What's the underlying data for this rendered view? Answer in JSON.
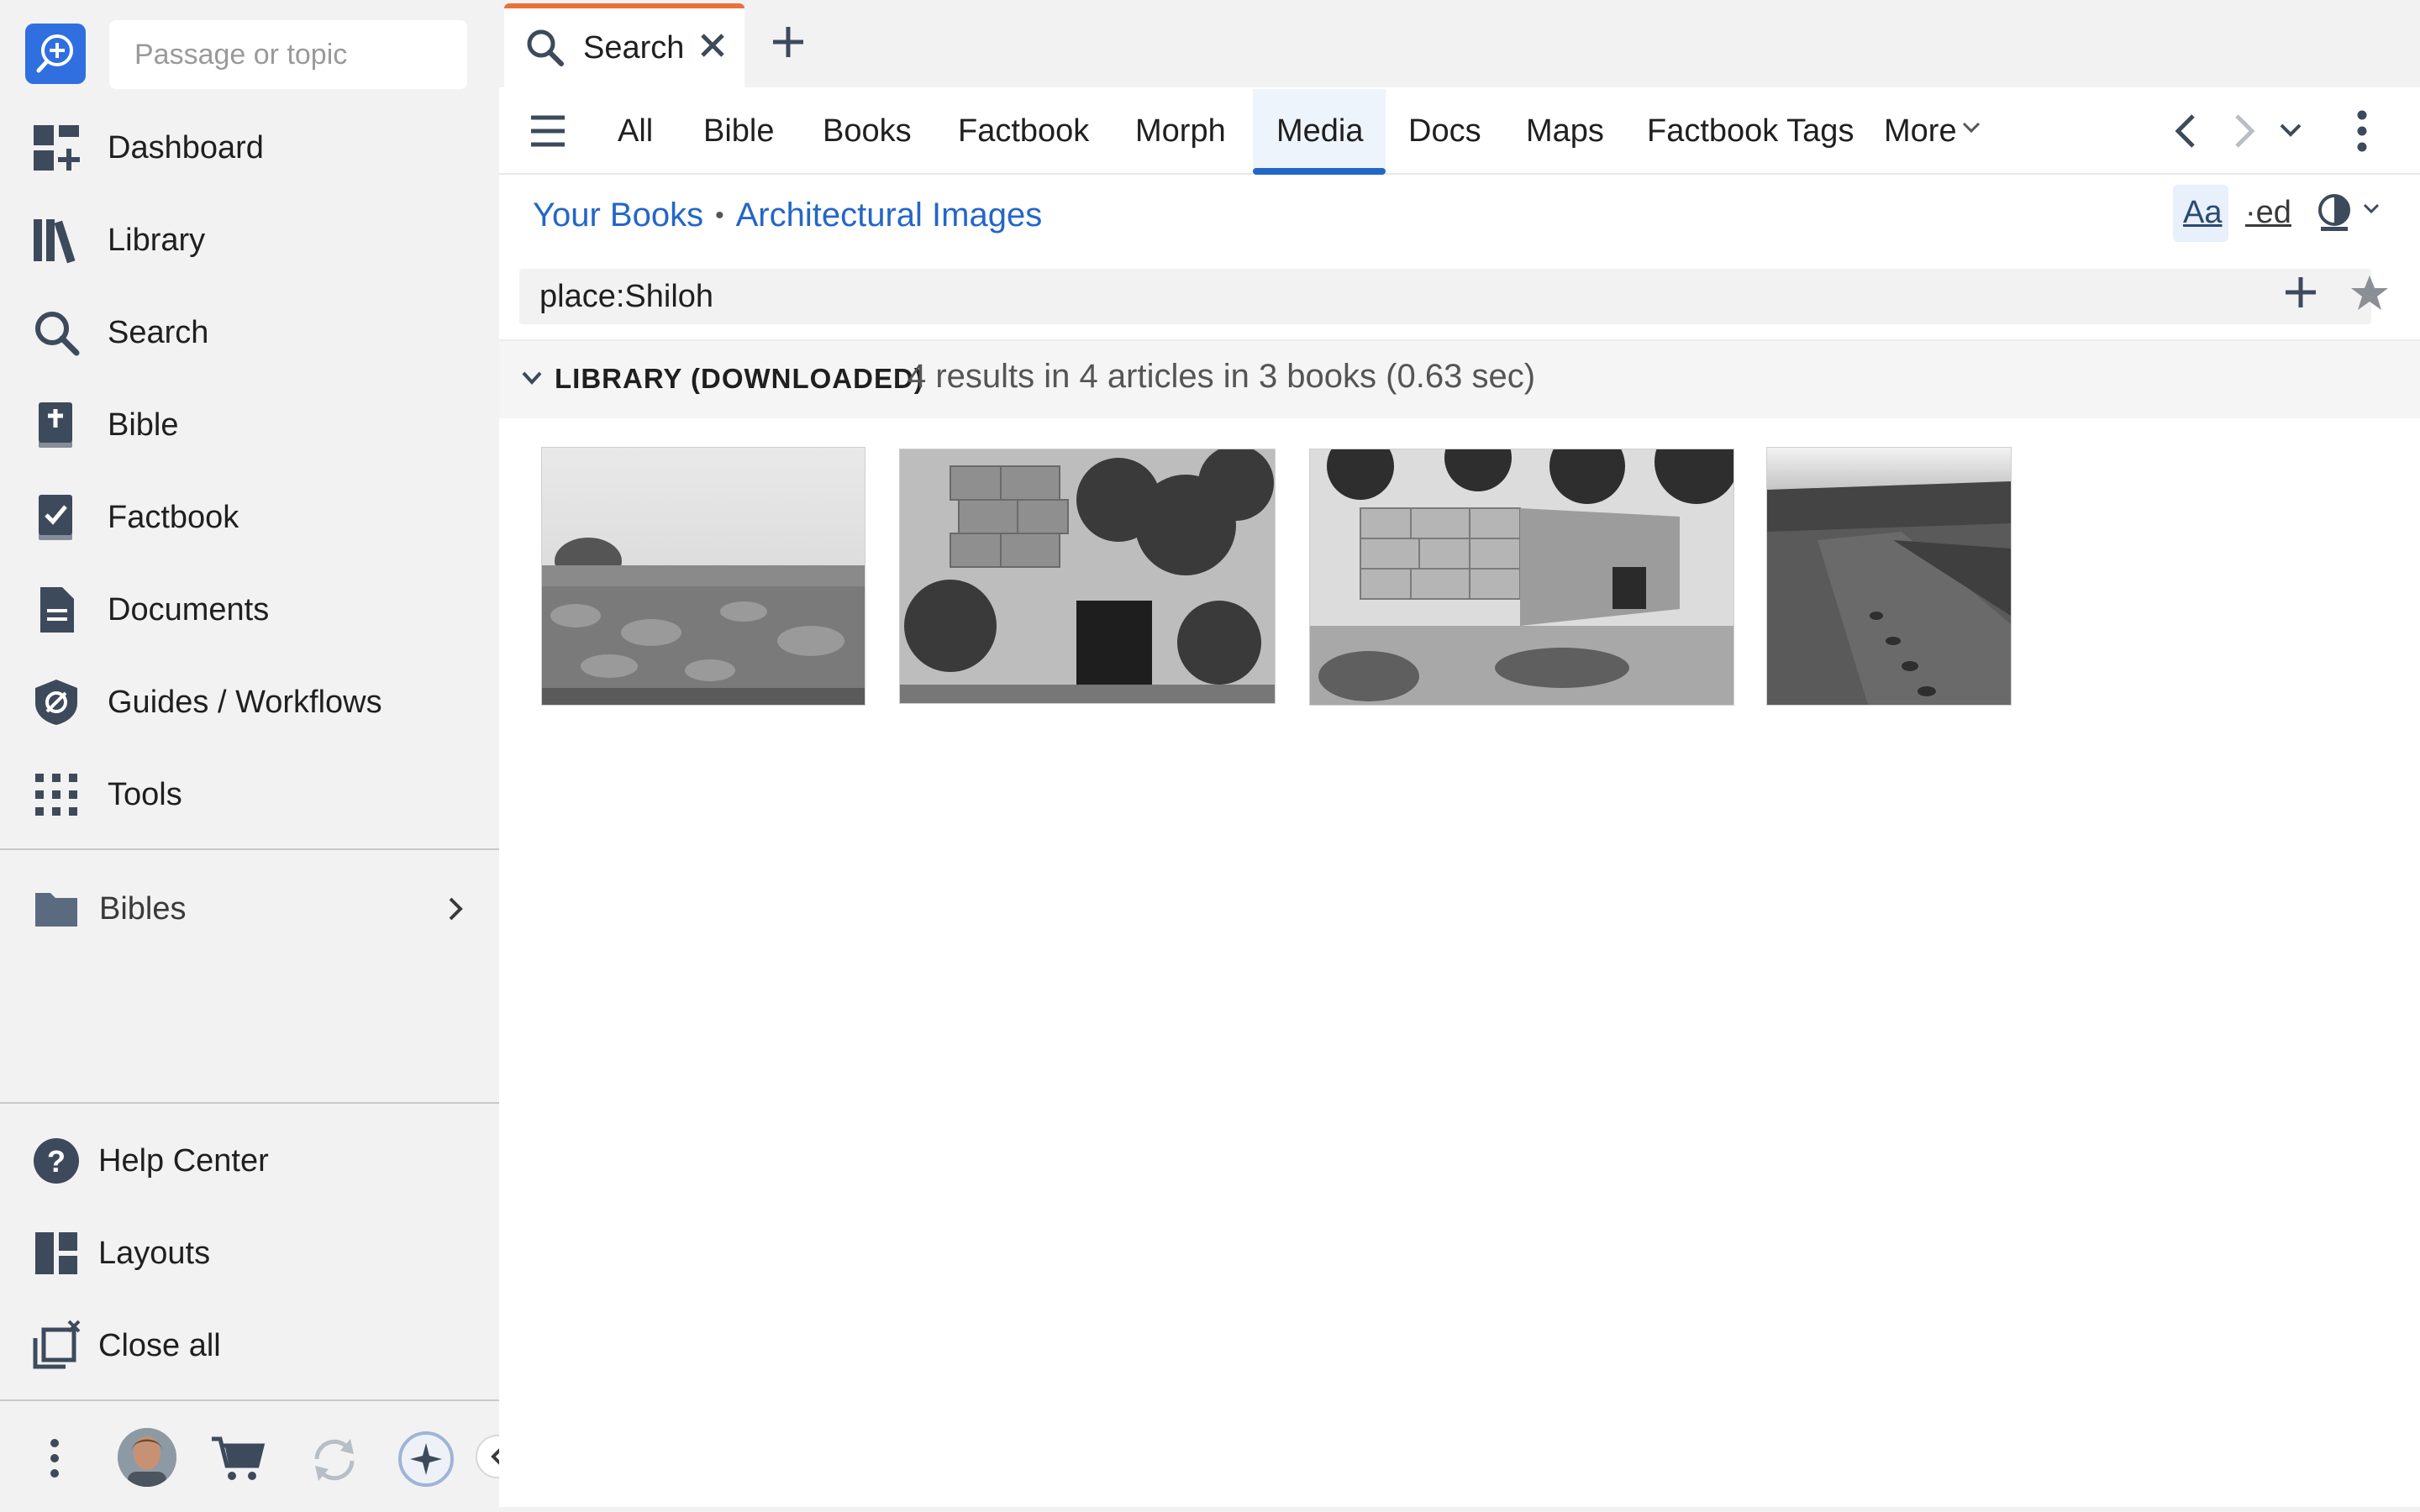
{
  "sidebar": {
    "search_placeholder": "Passage or topic",
    "nav": [
      {
        "label": "Dashboard",
        "icon": "dashboard-icon"
      },
      {
        "label": "Library",
        "icon": "library-icon"
      },
      {
        "label": "Search",
        "icon": "search-icon"
      },
      {
        "label": "Bible",
        "icon": "bible-icon"
      },
      {
        "label": "Factbook",
        "icon": "factbook-icon"
      },
      {
        "label": "Documents",
        "icon": "documents-icon"
      },
      {
        "label": "Guides / Workflows",
        "icon": "guides-icon"
      },
      {
        "label": "Tools",
        "icon": "tools-icon"
      }
    ],
    "folder": {
      "label": "Bibles",
      "icon": "folder-icon"
    },
    "bottom": [
      {
        "label": "Help Center",
        "icon": "help-icon"
      },
      {
        "label": "Layouts",
        "icon": "layouts-icon"
      },
      {
        "label": "Close all",
        "icon": "close-all-icon"
      }
    ],
    "bottom_bar_icons": [
      "more-vertical-icon",
      "avatar",
      "cart-icon",
      "sync-icon",
      "ai-assistant-icon"
    ]
  },
  "tabs": {
    "active": {
      "label": "Search",
      "icon": "search-icon"
    }
  },
  "filter_tabs": [
    "All",
    "Bible",
    "Books",
    "Factbook",
    "Morph",
    "Media",
    "Docs",
    "Maps",
    "Factbook Tags",
    "More"
  ],
  "active_filter": "Media",
  "breadcrumb": [
    "Your Books",
    "Architectural Images"
  ],
  "toolbar": {
    "font_label": "Aa",
    "ed_label": "·ed"
  },
  "search": {
    "query": "place:Shiloh"
  },
  "results": {
    "section": "LIBRARY (DOWNLOADED)",
    "summary": "4 results in 4 articles in 3 books (0.63 sec)",
    "thumbnails": [
      "Shiloh landscape with stone rubble",
      "Stone wall with doorway and foliage",
      "Ruined stone block structure",
      "Excavated trench on hillside"
    ]
  },
  "colors": {
    "accent": "#2466c8",
    "tab_indicator": "#e8713a",
    "logo": "#2f6fe0",
    "icon": "#3d4a5c"
  }
}
